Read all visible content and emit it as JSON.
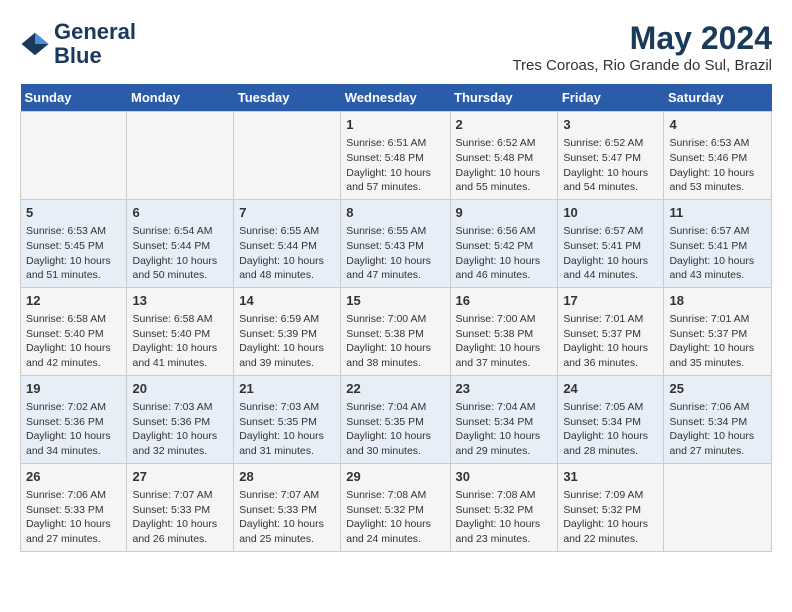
{
  "header": {
    "logo_line1": "General",
    "logo_line2": "Blue",
    "title": "May 2024",
    "subtitle": "Tres Coroas, Rio Grande do Sul, Brazil"
  },
  "calendar": {
    "days_of_week": [
      "Sunday",
      "Monday",
      "Tuesday",
      "Wednesday",
      "Thursday",
      "Friday",
      "Saturday"
    ],
    "weeks": [
      [
        {
          "day": "",
          "content": ""
        },
        {
          "day": "",
          "content": ""
        },
        {
          "day": "",
          "content": ""
        },
        {
          "day": "1",
          "content": "Sunrise: 6:51 AM\nSunset: 5:48 PM\nDaylight: 10 hours\nand 57 minutes."
        },
        {
          "day": "2",
          "content": "Sunrise: 6:52 AM\nSunset: 5:48 PM\nDaylight: 10 hours\nand 55 minutes."
        },
        {
          "day": "3",
          "content": "Sunrise: 6:52 AM\nSunset: 5:47 PM\nDaylight: 10 hours\nand 54 minutes."
        },
        {
          "day": "4",
          "content": "Sunrise: 6:53 AM\nSunset: 5:46 PM\nDaylight: 10 hours\nand 53 minutes."
        }
      ],
      [
        {
          "day": "5",
          "content": "Sunrise: 6:53 AM\nSunset: 5:45 PM\nDaylight: 10 hours\nand 51 minutes."
        },
        {
          "day": "6",
          "content": "Sunrise: 6:54 AM\nSunset: 5:44 PM\nDaylight: 10 hours\nand 50 minutes."
        },
        {
          "day": "7",
          "content": "Sunrise: 6:55 AM\nSunset: 5:44 PM\nDaylight: 10 hours\nand 48 minutes."
        },
        {
          "day": "8",
          "content": "Sunrise: 6:55 AM\nSunset: 5:43 PM\nDaylight: 10 hours\nand 47 minutes."
        },
        {
          "day": "9",
          "content": "Sunrise: 6:56 AM\nSunset: 5:42 PM\nDaylight: 10 hours\nand 46 minutes."
        },
        {
          "day": "10",
          "content": "Sunrise: 6:57 AM\nSunset: 5:41 PM\nDaylight: 10 hours\nand 44 minutes."
        },
        {
          "day": "11",
          "content": "Sunrise: 6:57 AM\nSunset: 5:41 PM\nDaylight: 10 hours\nand 43 minutes."
        }
      ],
      [
        {
          "day": "12",
          "content": "Sunrise: 6:58 AM\nSunset: 5:40 PM\nDaylight: 10 hours\nand 42 minutes."
        },
        {
          "day": "13",
          "content": "Sunrise: 6:58 AM\nSunset: 5:40 PM\nDaylight: 10 hours\nand 41 minutes."
        },
        {
          "day": "14",
          "content": "Sunrise: 6:59 AM\nSunset: 5:39 PM\nDaylight: 10 hours\nand 39 minutes."
        },
        {
          "day": "15",
          "content": "Sunrise: 7:00 AM\nSunset: 5:38 PM\nDaylight: 10 hours\nand 38 minutes."
        },
        {
          "day": "16",
          "content": "Sunrise: 7:00 AM\nSunset: 5:38 PM\nDaylight: 10 hours\nand 37 minutes."
        },
        {
          "day": "17",
          "content": "Sunrise: 7:01 AM\nSunset: 5:37 PM\nDaylight: 10 hours\nand 36 minutes."
        },
        {
          "day": "18",
          "content": "Sunrise: 7:01 AM\nSunset: 5:37 PM\nDaylight: 10 hours\nand 35 minutes."
        }
      ],
      [
        {
          "day": "19",
          "content": "Sunrise: 7:02 AM\nSunset: 5:36 PM\nDaylight: 10 hours\nand 34 minutes."
        },
        {
          "day": "20",
          "content": "Sunrise: 7:03 AM\nSunset: 5:36 PM\nDaylight: 10 hours\nand 32 minutes."
        },
        {
          "day": "21",
          "content": "Sunrise: 7:03 AM\nSunset: 5:35 PM\nDaylight: 10 hours\nand 31 minutes."
        },
        {
          "day": "22",
          "content": "Sunrise: 7:04 AM\nSunset: 5:35 PM\nDaylight: 10 hours\nand 30 minutes."
        },
        {
          "day": "23",
          "content": "Sunrise: 7:04 AM\nSunset: 5:34 PM\nDaylight: 10 hours\nand 29 minutes."
        },
        {
          "day": "24",
          "content": "Sunrise: 7:05 AM\nSunset: 5:34 PM\nDaylight: 10 hours\nand 28 minutes."
        },
        {
          "day": "25",
          "content": "Sunrise: 7:06 AM\nSunset: 5:34 PM\nDaylight: 10 hours\nand 27 minutes."
        }
      ],
      [
        {
          "day": "26",
          "content": "Sunrise: 7:06 AM\nSunset: 5:33 PM\nDaylight: 10 hours\nand 27 minutes."
        },
        {
          "day": "27",
          "content": "Sunrise: 7:07 AM\nSunset: 5:33 PM\nDaylight: 10 hours\nand 26 minutes."
        },
        {
          "day": "28",
          "content": "Sunrise: 7:07 AM\nSunset: 5:33 PM\nDaylight: 10 hours\nand 25 minutes."
        },
        {
          "day": "29",
          "content": "Sunrise: 7:08 AM\nSunset: 5:32 PM\nDaylight: 10 hours\nand 24 minutes."
        },
        {
          "day": "30",
          "content": "Sunrise: 7:08 AM\nSunset: 5:32 PM\nDaylight: 10 hours\nand 23 minutes."
        },
        {
          "day": "31",
          "content": "Sunrise: 7:09 AM\nSunset: 5:32 PM\nDaylight: 10 hours\nand 22 minutes."
        },
        {
          "day": "",
          "content": ""
        }
      ]
    ]
  }
}
